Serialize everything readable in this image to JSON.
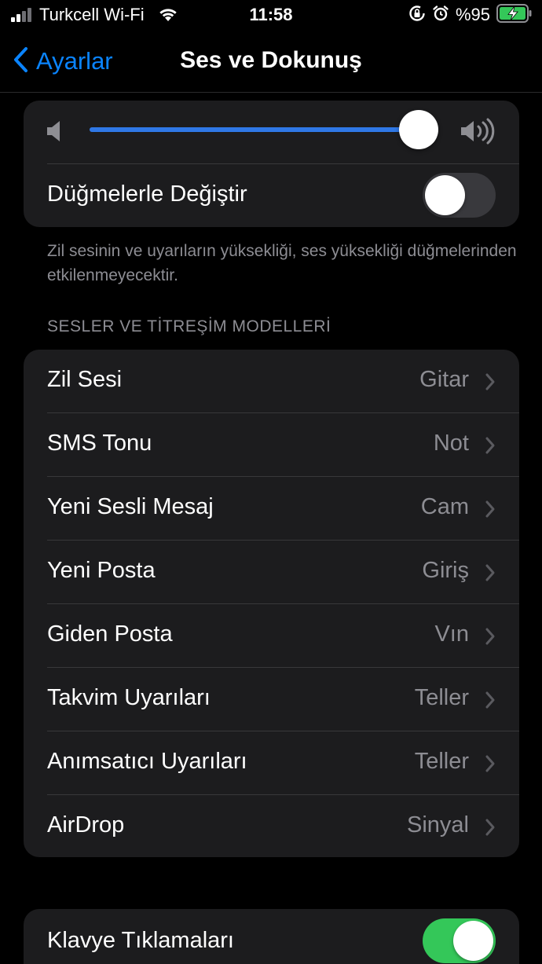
{
  "status_bar": {
    "carrier": "Turkcell Wi-Fi",
    "time": "11:58",
    "battery": "%95"
  },
  "nav": {
    "back_label": "Ayarlar",
    "title": "Ses ve Dokunuş"
  },
  "volume": {
    "level": 0.96,
    "change_with_buttons_label": "Düğmelerle Değiştir",
    "change_with_buttons_on": false,
    "footnote": "Zil sesinin ve uyarıların yüksekliği, ses yüksekliği düğmelerinden etkilenmeyecektir."
  },
  "sounds_section": {
    "header": "SESLER VE TİTREŞİM MODELLERİ",
    "items": [
      {
        "label": "Zil Sesi",
        "value": "Gitar"
      },
      {
        "label": "SMS Tonu",
        "value": "Not"
      },
      {
        "label": "Yeni Sesli Mesaj",
        "value": "Cam"
      },
      {
        "label": "Yeni Posta",
        "value": "Giriş"
      },
      {
        "label": "Giden Posta",
        "value": "Vın"
      },
      {
        "label": "Takvim Uyarıları",
        "value": "Teller"
      },
      {
        "label": "Anımsatıcı Uyarıları",
        "value": "Teller"
      },
      {
        "label": "AirDrop",
        "value": "Sinyal"
      }
    ]
  },
  "keyboard": {
    "label": "Klavye Tıklamaları",
    "on": true
  },
  "colors": {
    "accent": "#0a84ff",
    "slider_fill": "#2f78e6",
    "toggle_on": "#34c759",
    "battery_fill": "#34c759"
  }
}
